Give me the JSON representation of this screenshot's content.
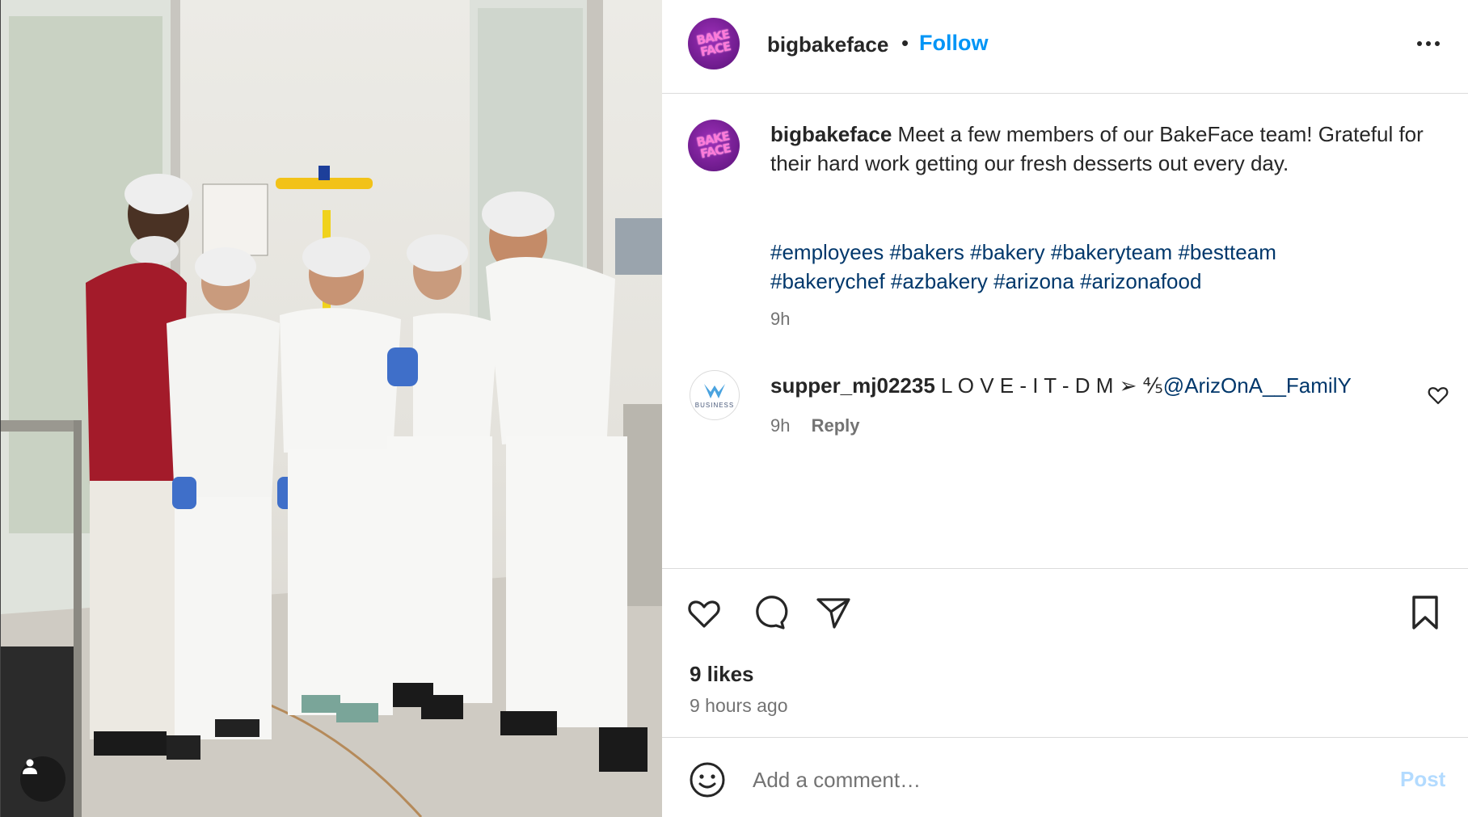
{
  "post": {
    "username": "bigbakeface",
    "follow_label": "Follow",
    "separator": "•",
    "avatar_logo_line1": "BAKE",
    "avatar_logo_line2": "FACE"
  },
  "caption": {
    "username": "bigbakeface",
    "text": "Meet a few members of our BakeFace team! Grateful for their hard work getting our fresh desserts out every day.",
    "hashtags": [
      "#employees",
      "#bakers",
      "#bakery",
      "#bakeryteam",
      "#bestteam",
      "#bakerychef",
      "#azbakery",
      "#arizona",
      "#arizonafood"
    ],
    "time": "9h"
  },
  "comment": {
    "username": "supper_mj02235",
    "text": "L O V E - I T - D M ➢ ⅘",
    "mention": "@ArizOnA__FamilY",
    "time": "9h",
    "reply_label": "Reply",
    "avatar_label": "BUSINESS"
  },
  "engagement": {
    "likes": "9 likes",
    "posted_ago": "9 hours ago"
  },
  "comment_form": {
    "placeholder": "Add a comment…",
    "post_label": "Post"
  },
  "colors": {
    "follow": "#0095f6",
    "hashtag": "#00376b",
    "post_disabled": "#b3dbff",
    "brand_purple": "#6d1b8c",
    "brand_pink": "#ff7ad9"
  },
  "icons": [
    "more-options-icon",
    "heart-icon",
    "comment-icon",
    "share-icon",
    "bookmark-icon",
    "emoji-icon",
    "user-tag-icon"
  ]
}
